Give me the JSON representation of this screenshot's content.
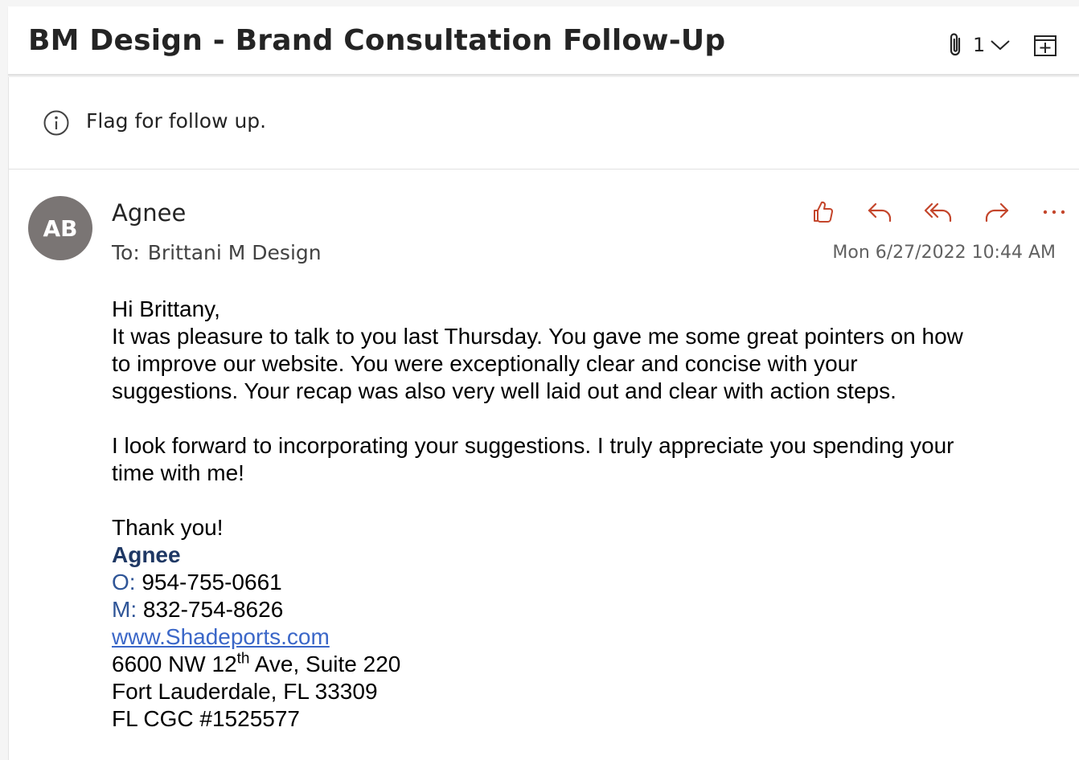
{
  "email": {
    "subject": "BM Design - Brand Consultation Follow-Up",
    "attachment_count": "1",
    "info_message": "Flag for follow up.",
    "avatar_initials": "AB",
    "sender_name": "Agnee",
    "to_label": "To:",
    "recipient": "Brittani M Design",
    "date": "Mon 6/27/2022 10:44 AM"
  },
  "actions": [
    {
      "name": "like",
      "icon": "thumbs-up-icon"
    },
    {
      "name": "reply",
      "icon": "reply-icon"
    },
    {
      "name": "reply-all",
      "icon": "reply-all-icon"
    },
    {
      "name": "forward",
      "icon": "forward-icon"
    },
    {
      "name": "more",
      "icon": "more-icon"
    }
  ],
  "body": {
    "greeting": "Hi Brittany,",
    "para1_line1": "It was pleasure to talk to you last Thursday. You gave me some great pointers on how",
    "para1_line2": "to improve our website. You were exceptionally clear and concise with your",
    "para1_line3": "suggestions. Your recap was also very well laid out and clear with action steps.",
    "para2_line1": "I look forward to incorporating your suggestions. I truly appreciate you spending your",
    "para2_line2": "time with me!",
    "closing": "Thank you!"
  },
  "signature": {
    "name": "Agnee",
    "office_label": "O:",
    "office_phone": "954-755-0661",
    "mobile_label": "M:",
    "mobile_phone": "832-754-8626",
    "website": "www.Shadeports.com",
    "address_pre": "6600 NW 12",
    "address_sup": "th",
    "address_post": " Ave, Suite 220",
    "city_line": "Fort Lauderdale, FL 33309",
    "license": "FL CGC #1525577"
  },
  "colors": {
    "accent_action": "#c4462c",
    "avatar_bg": "#7a7574",
    "signature_name": "#1f3864",
    "link": "#3b67c8"
  }
}
